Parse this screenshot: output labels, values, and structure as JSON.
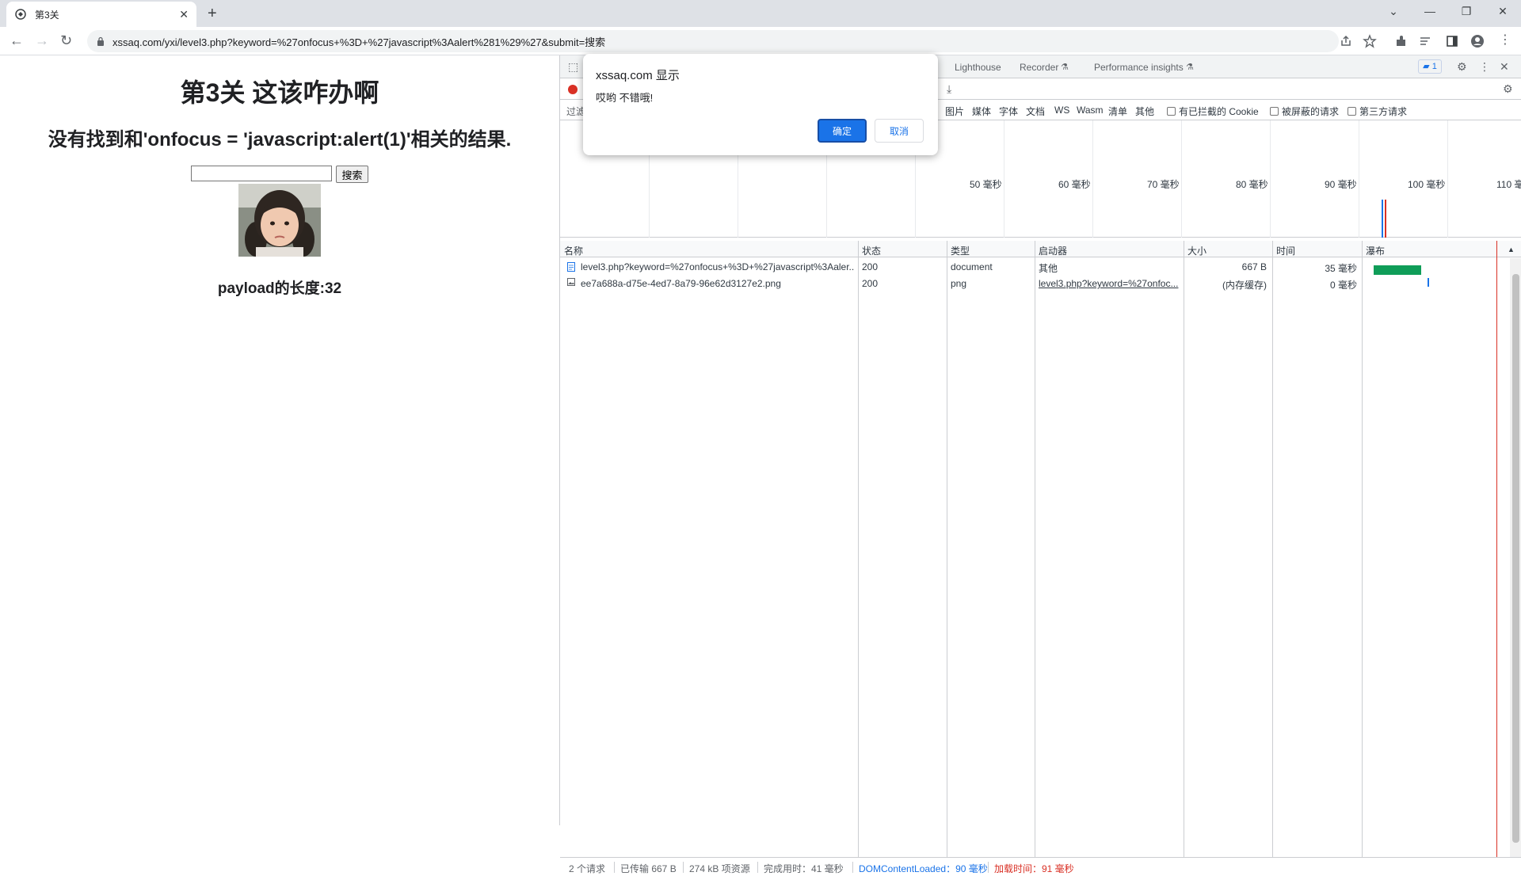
{
  "browser": {
    "tab_title": "第3关",
    "url": "xssaq.com/yxi/level3.php?keyword=%27onfocus+%3D+%27javascript%3Aalert%281%29%27&submit=搜索"
  },
  "page": {
    "heading": "第3关 这该咋办啊",
    "result_text": "没有找到和'onfocus = 'javascript:alert(1)'相关的结果.",
    "search_value": "",
    "search_button": "搜索",
    "payload_text": "payload的长度:32"
  },
  "dialog": {
    "title": "xssaq.com 显示",
    "message": "哎哟 不错哦!",
    "ok_label": "确定",
    "cancel_label": "取消"
  },
  "devtools": {
    "tabs": [
      "Lighthouse",
      "Recorder",
      "Performance insights"
    ],
    "issue_badge": "1",
    "filter_label": "过滤",
    "filter_types": [
      "图片",
      "媒体",
      "字体",
      "文档",
      "WS",
      "Wasm",
      "清单",
      "其他"
    ],
    "checkboxes": [
      "有已拦截的 Cookie",
      "被屏蔽的请求",
      "第三方请求"
    ],
    "timeline_ticks": [
      "50 毫秒",
      "60 毫秒",
      "70 毫秒",
      "80 毫秒",
      "90 毫秒",
      "100 毫秒",
      "110 毫"
    ],
    "columns": {
      "name": "名称",
      "status": "状态",
      "type": "类型",
      "initiator": "启动器",
      "size": "大小",
      "time": "时间",
      "waterfall": "瀑布"
    },
    "rows": [
      {
        "name": "level3.php?keyword=%27onfocus+%3D+%27javascript%3Aaler...",
        "status": "200",
        "type": "document",
        "initiator": "其他",
        "size": "667 B",
        "time": "35 毫秒"
      },
      {
        "name": "ee7a688a-d75e-4ed7-8a79-96e62d3127e2.png",
        "status": "200",
        "type": "png",
        "initiator": "level3.php?keyword=%27onfoc...",
        "size": "(内存缓存)",
        "time": "0 毫秒"
      }
    ],
    "status_bar": {
      "requests": "2 个请求",
      "transferred": "已传输 667 B",
      "resources": "274 kB 项资源",
      "finish": "完成用时：41 毫秒",
      "dcl": "DOMContentLoaded：90 毫秒",
      "load": "加载时间：91 毫秒"
    },
    "colors": {
      "dcl": "#1a73e8",
      "load": "#d93025",
      "waterfall": "#0f9d58"
    }
  }
}
